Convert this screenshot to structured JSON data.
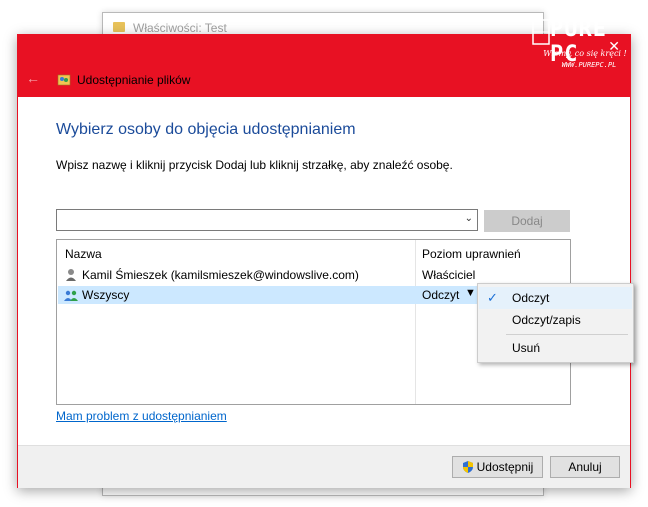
{
  "background_window": {
    "title": "Właściwości: Test"
  },
  "dialog": {
    "title": "Udostępnianie plików",
    "heading": "Wybierz osoby do objęcia udostępnianiem",
    "instruction": "Wpisz nazwę i kliknij przycisk Dodaj lub kliknij strzałkę, aby znaleźć osobę.",
    "combo_value": "",
    "add_button": "Dodaj",
    "columns": {
      "name": "Nazwa",
      "level": "Poziom uprawnień"
    },
    "rows": [
      {
        "name": "Kamil Śmieszek (kamilsmieszek@windowslive.com)",
        "level": "Właściciel",
        "icon": "user-icon"
      },
      {
        "name": "Wszyscy",
        "level": "Odczyt",
        "icon": "group-icon",
        "selected": true
      }
    ],
    "help_link": "Mam problem z udostępnianiem",
    "share_button": "Udostępnij",
    "cancel_button": "Anuluj"
  },
  "permission_menu": {
    "items": [
      {
        "label": "Odczyt",
        "checked": true
      },
      {
        "label": "Odczyt/zapis",
        "checked": false
      },
      {
        "label": "Usuń",
        "checked": false
      }
    ]
  },
  "watermark": {
    "brand": "PurePC",
    "tagline": "Wiemy, co się kręci !",
    "url": "WWW.PUREPC.PL"
  },
  "colors": {
    "titlebar": "#e81123",
    "heading": "#1b4b9a",
    "link": "#0066cc",
    "selection": "#cce8ff"
  }
}
